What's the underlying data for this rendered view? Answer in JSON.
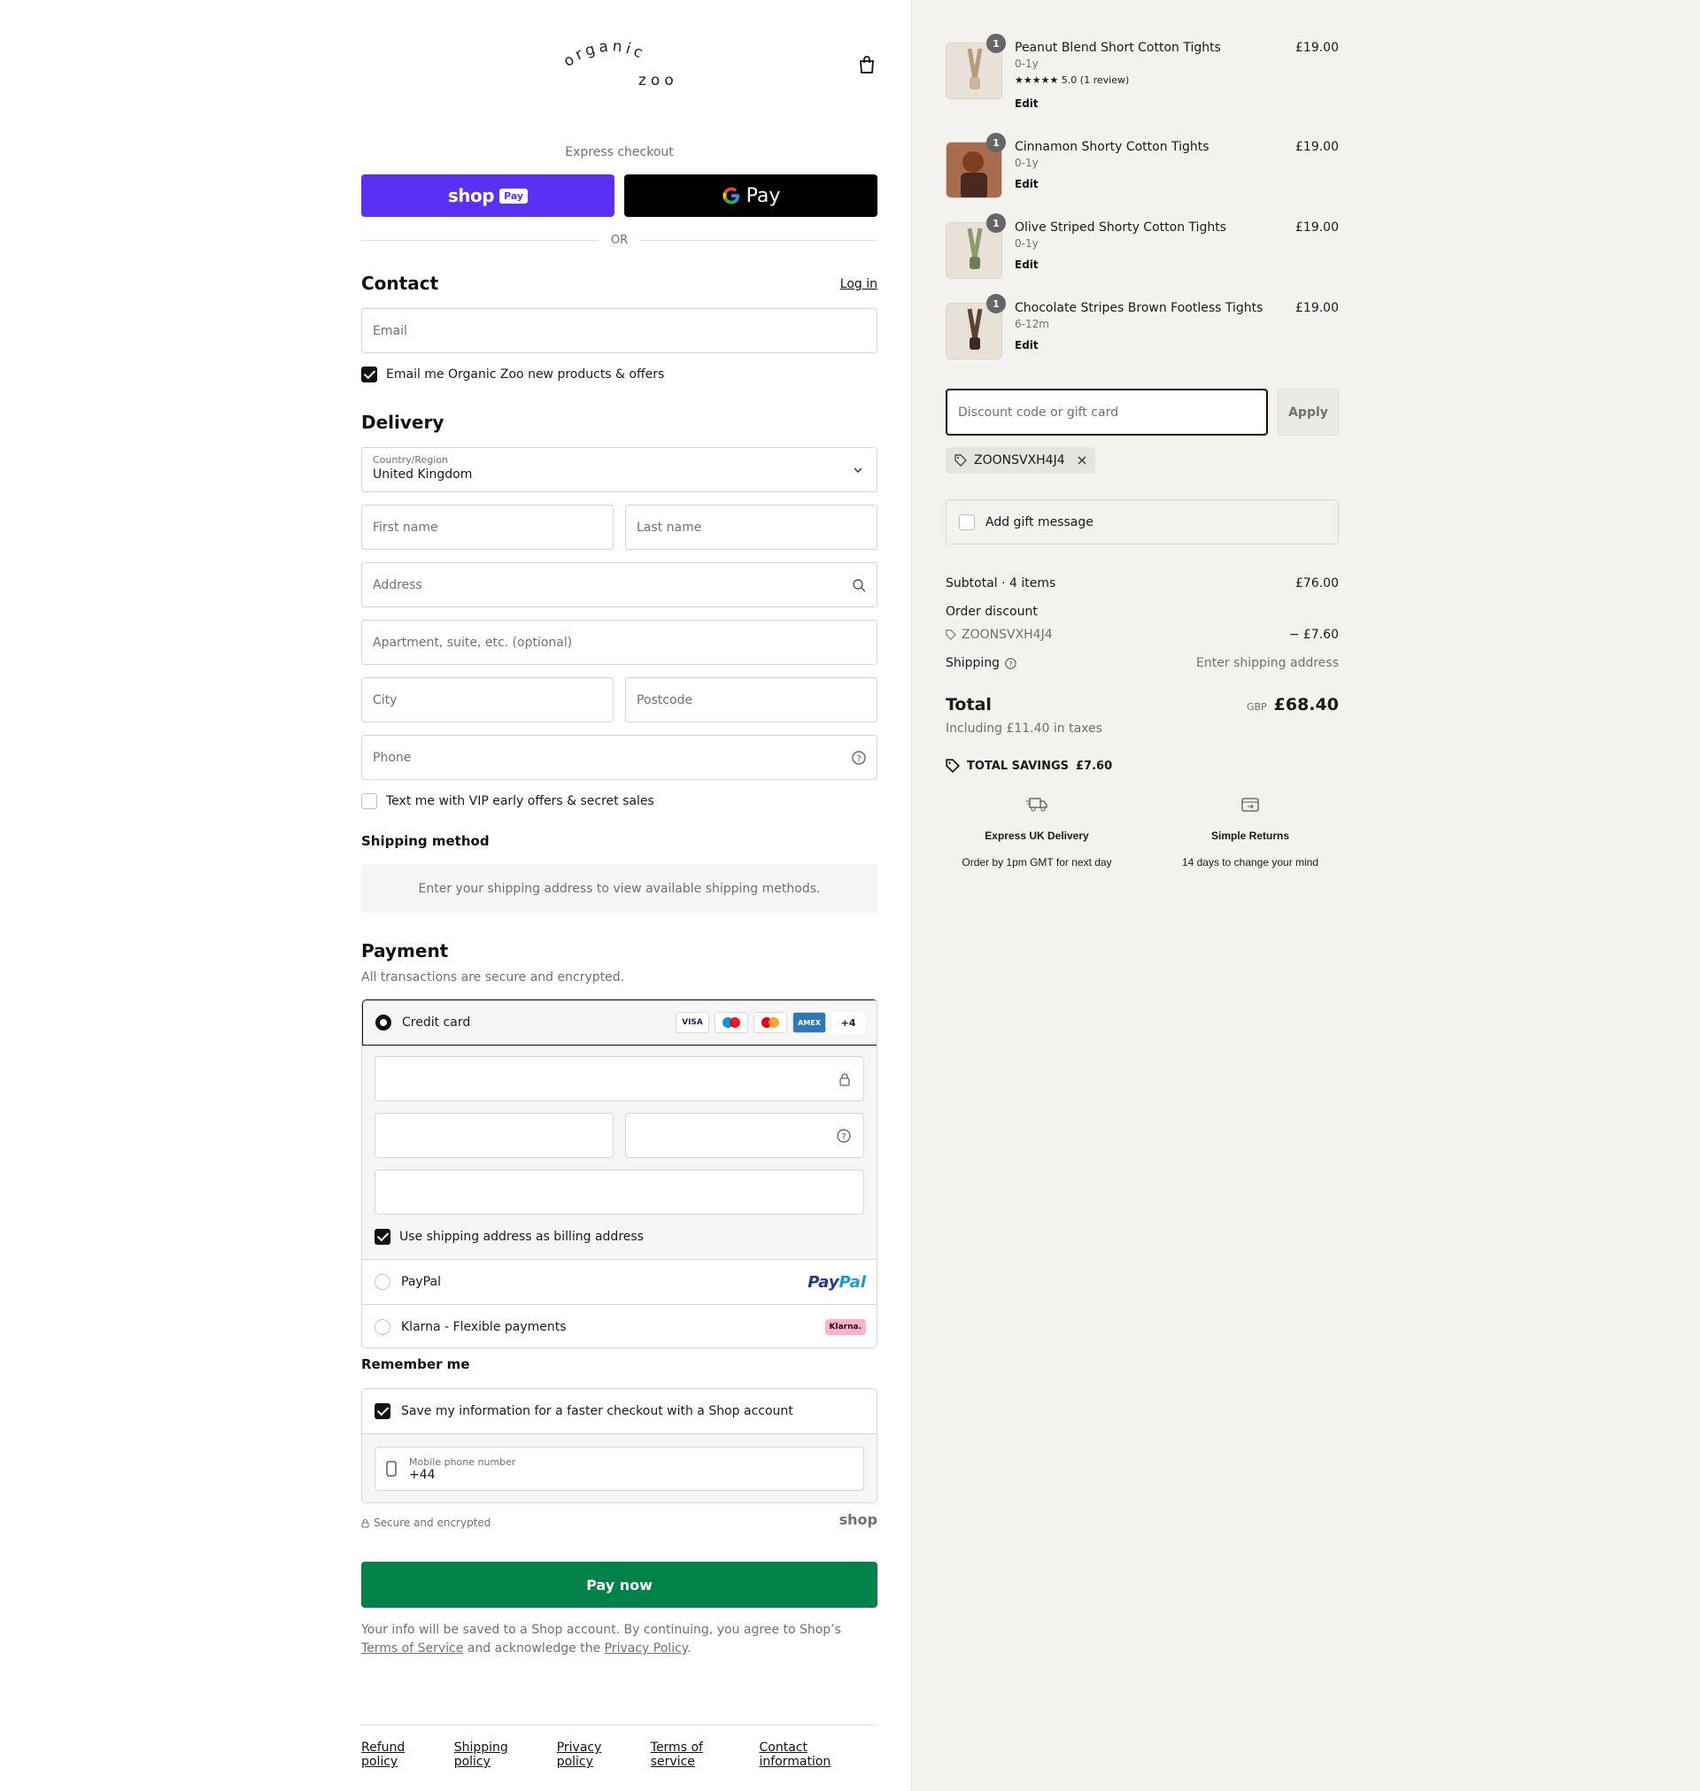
{
  "brand": {
    "logo_top": "organic",
    "logo_bottom": "zoo"
  },
  "express": {
    "label": "Express checkout",
    "shop_word": "shop",
    "shop_pay": "Pay",
    "gpay": "Pay",
    "or": "OR"
  },
  "contact": {
    "title": "Contact",
    "login": "Log in",
    "email_placeholder": "Email",
    "newsletter": "Email me Organic Zoo new products & offers"
  },
  "delivery": {
    "title": "Delivery",
    "country_label": "Country/Region",
    "country_value": "United Kingdom",
    "first_name": "First name",
    "last_name": "Last name",
    "address": "Address",
    "apartment": "Apartment, suite, etc. (optional)",
    "city": "City",
    "postcode": "Postcode",
    "phone": "Phone",
    "sms_optin": "Text me with VIP early offers & secret sales"
  },
  "shipping_method": {
    "title": "Shipping method",
    "info": "Enter your shipping address to view available shipping methods."
  },
  "payment": {
    "title": "Payment",
    "subtitle": "All transactions are secure and encrypted.",
    "credit_card": "Credit card",
    "cards": [
      "VISA",
      "",
      "",
      "AMEX",
      "+4"
    ],
    "billing_same": "Use shipping address as billing address",
    "paypal": "PayPal",
    "paypal_logo_a": "Pay",
    "paypal_logo_b": "Pal",
    "klarna": "Klarna - Flexible payments",
    "klarna_badge": "Klarna."
  },
  "remember": {
    "title": "Remember me",
    "save": "Save my information for a faster checkout with a Shop account",
    "mobile_label": "Mobile phone number",
    "mobile_value": "+44",
    "secure": "Secure and encrypted",
    "shop": "shop"
  },
  "paynow": "Pay now",
  "legal": {
    "text1": "Your info will be saved to a Shop account. By continuing, you agree to Shop’s ",
    "tos": "Terms of Service",
    "text2": " and acknowledge the ",
    "privacy": "Privacy Policy",
    "text3": "."
  },
  "footer": [
    "Refund policy",
    "Shipping policy",
    "Privacy policy",
    "Terms of service",
    "Contact information"
  ],
  "cart": {
    "items": [
      {
        "qty": "1",
        "name": "Peanut Blend Short Cotton Tights",
        "variant": "0-1y",
        "rating": "★★★★★  5.0 (1 review)",
        "edit": "Edit",
        "price": "£19.00"
      },
      {
        "qty": "1",
        "name": "Cinnamon Shorty Cotton Tights",
        "variant": "0-1y",
        "rating": "",
        "edit": "Edit",
        "price": "£19.00"
      },
      {
        "qty": "1",
        "name": "Olive Striped Shorty Cotton Tights",
        "variant": "0-1y",
        "rating": "",
        "edit": "Edit",
        "price": "£19.00"
      },
      {
        "qty": "1",
        "name": "Chocolate Stripes Brown Footless Tights",
        "variant": "6-12m",
        "rating": "",
        "edit": "Edit",
        "price": "£19.00"
      }
    ],
    "discount_placeholder": "Discount code or gift card",
    "apply": "Apply",
    "code": "ZOONSVXH4J4",
    "gift_message": "Add gift message",
    "subtotal_label": "Subtotal · 4 items",
    "subtotal": "£76.00",
    "order_discount": "Order discount",
    "discount_amount": "− £7.60",
    "shipping_label": "Shipping",
    "shipping_value": "Enter shipping address",
    "total_label": "Total",
    "currency": "GBP",
    "total": "£68.40",
    "tax": "Including £11.40 in taxes",
    "savings_label": "TOTAL SAVINGS",
    "savings": "£7.60"
  },
  "features": [
    {
      "icon": "truck-icon",
      "title": "Express UK Delivery",
      "sub": "Order by 1pm GMT for next day"
    },
    {
      "icon": "returns-icon",
      "title": "Simple Returns",
      "sub": "14 days to change your mind"
    }
  ],
  "colors": {
    "shop_pay": "#5a31f4",
    "pay_now": "#008248",
    "right_bg": "#f3f2ef"
  }
}
